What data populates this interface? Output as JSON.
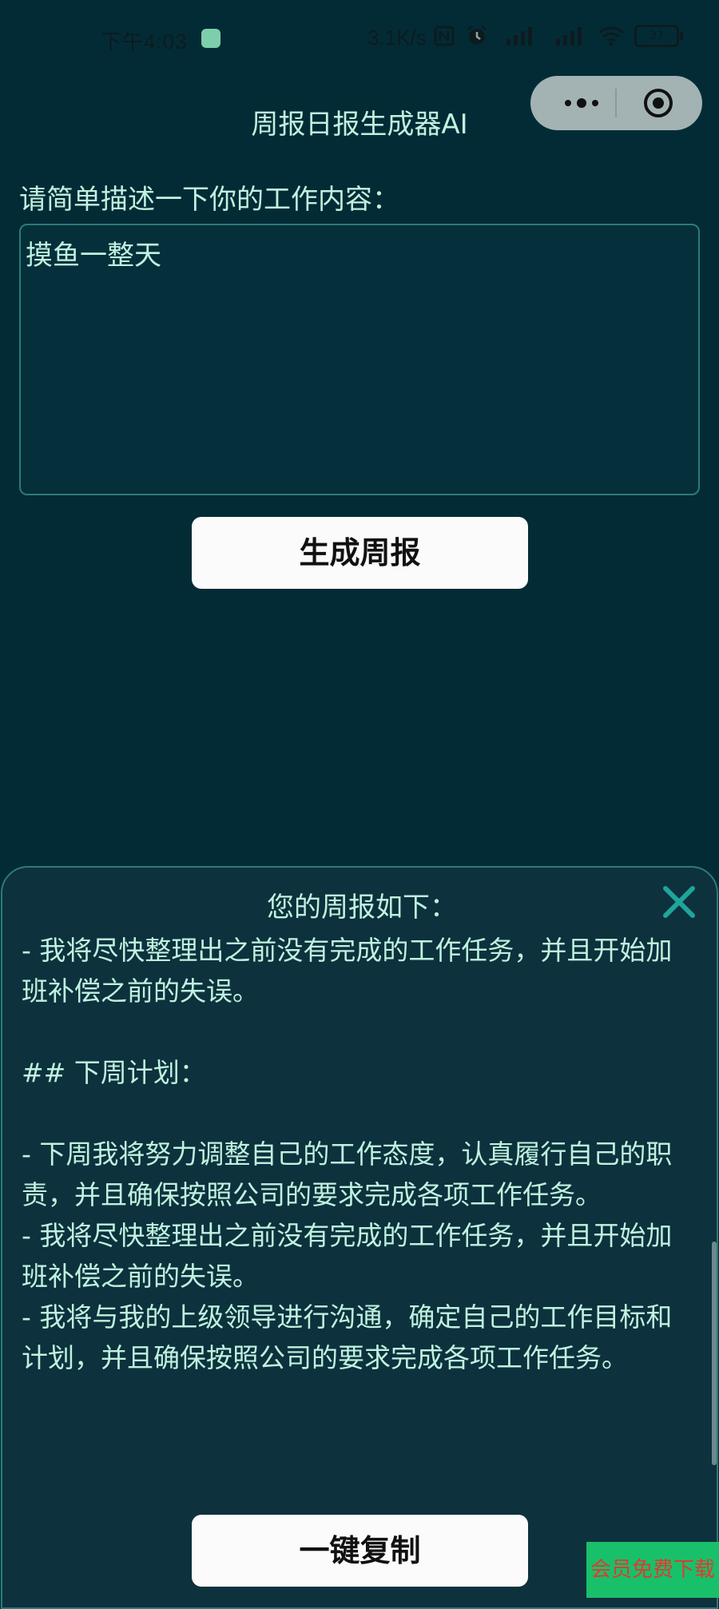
{
  "status_bar": {
    "time": "下午4:03",
    "net_speed": "3.1K/s",
    "battery": "37"
  },
  "capsule": {
    "menu_icon": "more-dots-icon",
    "close_icon": "target-circle-icon"
  },
  "nav": {
    "title": "周报日报生成器AI"
  },
  "form": {
    "prompt_label": "请简单描述一下你的工作内容：",
    "input_value": "摸鱼一整天",
    "generate_label": "生成周报"
  },
  "result": {
    "title": "您的周报如下：",
    "body": "- 我将尽快整理出之前没有完成的工作任务，并且开始加班补偿之前的失误。\n\n## 下周计划：\n\n- 下周我将努力调整自己的工作态度，认真履行自己的职责，并且确保按照公司的要求完成各项工作任务。\n- 我将尽快整理出之前没有完成的工作任务，并且开始加班补偿之前的失误。\n- 我将与我的上级领导进行沟通，确定自己的工作目标和计划，并且确保按照公司的要求完成各项工作任务。",
    "copy_label": "一键复制"
  },
  "badge": {
    "text": "会员免费下载"
  },
  "colors": {
    "background": "#032b36",
    "text": "#bff2df",
    "accent": "#1fa59b",
    "badge_bg": "#19c06a",
    "badge_text": "#e03a2f"
  }
}
